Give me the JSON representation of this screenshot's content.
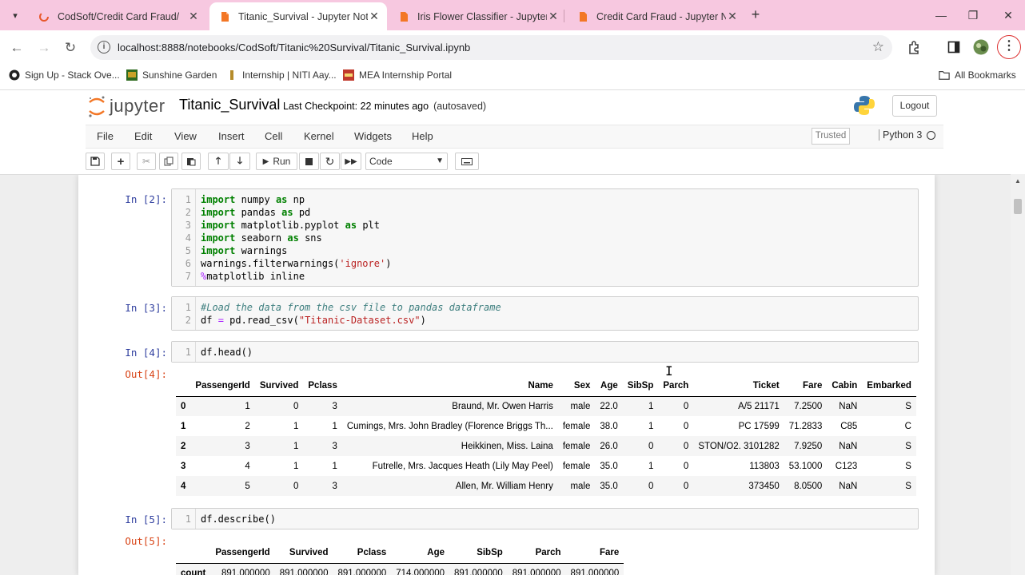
{
  "browser": {
    "tabs": [
      {
        "title": "CodSoft/Credit Card Fraud/",
        "active": false
      },
      {
        "title": "Titanic_Survival - Jupyter Noteb",
        "active": true
      },
      {
        "title": "Iris Flower Classifier - Jupyter N",
        "active": false
      },
      {
        "title": "Credit Card Fraud - Jupyter Not",
        "active": false
      }
    ],
    "url": "localhost:8888/notebooks/CodSoft/Titanic%20Survival/Titanic_Survival.ipynb",
    "bookmarks": [
      "Sign Up - Stack Ove...",
      "Sunshine Garden",
      "Internship | NITI Aay...",
      "MEA Internship Portal"
    ],
    "all_bookmarks": "All Bookmarks"
  },
  "jupyter": {
    "logo_text": "jupyter",
    "notebook_name": "Titanic_Survival",
    "checkpoint": "Last Checkpoint: 22 minutes ago",
    "autosaved": "(autosaved)",
    "logout": "Logout",
    "menu": [
      "File",
      "Edit",
      "View",
      "Insert",
      "Cell",
      "Kernel",
      "Widgets",
      "Help"
    ],
    "trusted": "Trusted",
    "kernel": "Python 3",
    "toolbar": {
      "run": "Run",
      "cell_type": "Code"
    }
  },
  "cells": {
    "c2": {
      "prompt": "In [2]:"
    },
    "c3": {
      "prompt": "In [3]:"
    },
    "c4": {
      "prompt": "In [4]:",
      "out_prompt": "Out[4]:",
      "code": "df.head()"
    },
    "c5": {
      "prompt": "In [5]:",
      "out_prompt": "Out[5]:",
      "code": "df.describe()"
    }
  },
  "head_table": {
    "columns": [
      "PassengerId",
      "Survived",
      "Pclass",
      "Name",
      "Sex",
      "Age",
      "SibSp",
      "Parch",
      "Ticket",
      "Fare",
      "Cabin",
      "Embarked"
    ],
    "rows": [
      [
        "0",
        "1",
        "0",
        "3",
        "Braund, Mr. Owen Harris",
        "male",
        "22.0",
        "1",
        "0",
        "A/5 21171",
        "7.2500",
        "NaN",
        "S"
      ],
      [
        "1",
        "2",
        "1",
        "1",
        "Cumings, Mrs. John Bradley (Florence Briggs Th...",
        "female",
        "38.0",
        "1",
        "0",
        "PC 17599",
        "71.2833",
        "C85",
        "C"
      ],
      [
        "2",
        "3",
        "1",
        "3",
        "Heikkinen, Miss. Laina",
        "female",
        "26.0",
        "0",
        "0",
        "STON/O2. 3101282",
        "7.9250",
        "NaN",
        "S"
      ],
      [
        "3",
        "4",
        "1",
        "1",
        "Futrelle, Mrs. Jacques Heath (Lily May Peel)",
        "female",
        "35.0",
        "1",
        "0",
        "113803",
        "53.1000",
        "C123",
        "S"
      ],
      [
        "4",
        "5",
        "0",
        "3",
        "Allen, Mr. William Henry",
        "male",
        "35.0",
        "0",
        "0",
        "373450",
        "8.0500",
        "NaN",
        "S"
      ]
    ]
  },
  "describe_table": {
    "columns": [
      "PassengerId",
      "Survived",
      "Pclass",
      "Age",
      "SibSp",
      "Parch",
      "Fare"
    ],
    "rows": [
      [
        "count",
        "891.000000",
        "891.000000",
        "891.000000",
        "714.000000",
        "891.000000",
        "891.000000",
        "891.000000"
      ]
    ]
  },
  "icons": [
    "chrome-menu-icon",
    "reload-icon",
    "back-icon",
    "forward-icon",
    "star-icon",
    "extensions-icon",
    "sidepanel-icon",
    "avatar",
    "kebab-menu-icon",
    "python-logo",
    "save-icon",
    "add-icon",
    "cut-icon",
    "copy-icon",
    "paste-icon",
    "up-icon",
    "down-icon",
    "run-icon",
    "stop-icon",
    "restart-icon",
    "fast-forward-icon",
    "keyboard-icon"
  ]
}
